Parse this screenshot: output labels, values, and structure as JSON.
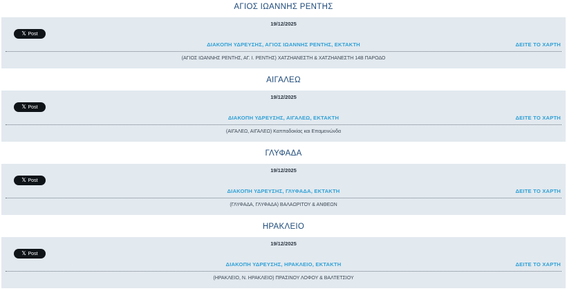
{
  "social": {
    "post_label": "Post",
    "x_glyph": "𝕏"
  },
  "notices": [
    {
      "heading": "ΑΓΙΟΣ ΙΩΑΝΝΗΣ ΡΕΝΤΗΣ",
      "date": "19/12/2025",
      "title": "ΔΙΑΚΟΠΗ ΥΔΡΕΥΣΗΣ, ΑΓΙΟΣ ΙΩΑΝΝΗΣ ΡΕΝΤΗΣ, ΕΚΤΑΚΤΗ",
      "map_link": "ΔΕΙΤΕ ΤΟ ΧΑΡΤΗ",
      "location": "(ΑΓΙΟΣ ΙΩΑΝΝΗΣ ΡΕΝΤΗΣ, ΑΓ. Ι. ΡΕΝΤΗΣ) ΧΑΤΖΗΑΝΕΣΤΗ & ΧΑΤΖΗΑΝΕΣΤΗ 14Β ΠΑΡΟΔΟ"
    },
    {
      "heading": "ΑΙΓΑΛΕΩ",
      "date": "19/12/2025",
      "title": "ΔΙΑΚΟΠΗ ΥΔΡΕΥΣΗΣ, ΑΙΓΑΛΕΩ, ΕΚΤΑΚΤΗ",
      "map_link": "ΔΕΙΤΕ ΤΟ ΧΑΡΤΗ",
      "location": "(ΑΙΓΑΛΕΩ, ΑΙΓΑΛΕΩ) Καππαδοκίας και Επαμεινώνδα"
    },
    {
      "heading": "ΓΛΥΦΑΔΑ",
      "date": "19/12/2025",
      "title": "ΔΙΑΚΟΠΗ ΥΔΡΕΥΣΗΣ, ΓΛΥΦΑΔΑ, ΕΚΤΑΚΤΗ",
      "map_link": "ΔΕΙΤΕ ΤΟ ΧΑΡΤΗ",
      "location": "(ΓΛΥΦΑΔΑ, ΓΛΥΦΑΔΑ) ΒΑΛΑΩΡΙΤΟΥ & ΑΝΘΕΩΝ"
    },
    {
      "heading": "ΗΡΑΚΛΕΙΟ",
      "date": "19/12/2025",
      "title": "ΔΙΑΚΟΠΗ ΥΔΡΕΥΣΗΣ, ΗΡΑΚΛΕΙΟ, ΕΚΤΑΚΤΗ",
      "map_link": "ΔΕΙΤΕ ΤΟ ΧΑΡΤΗ",
      "location": "(ΗΡΑΚΛΕΙΟ, Ν. ΗΡΑΚΛΕΙΟ) ΠΡΑΣΙΝΟΥ ΛΟΦΟΥ & ΒΑΛΤΕΤΣΙΟΥ"
    }
  ]
}
